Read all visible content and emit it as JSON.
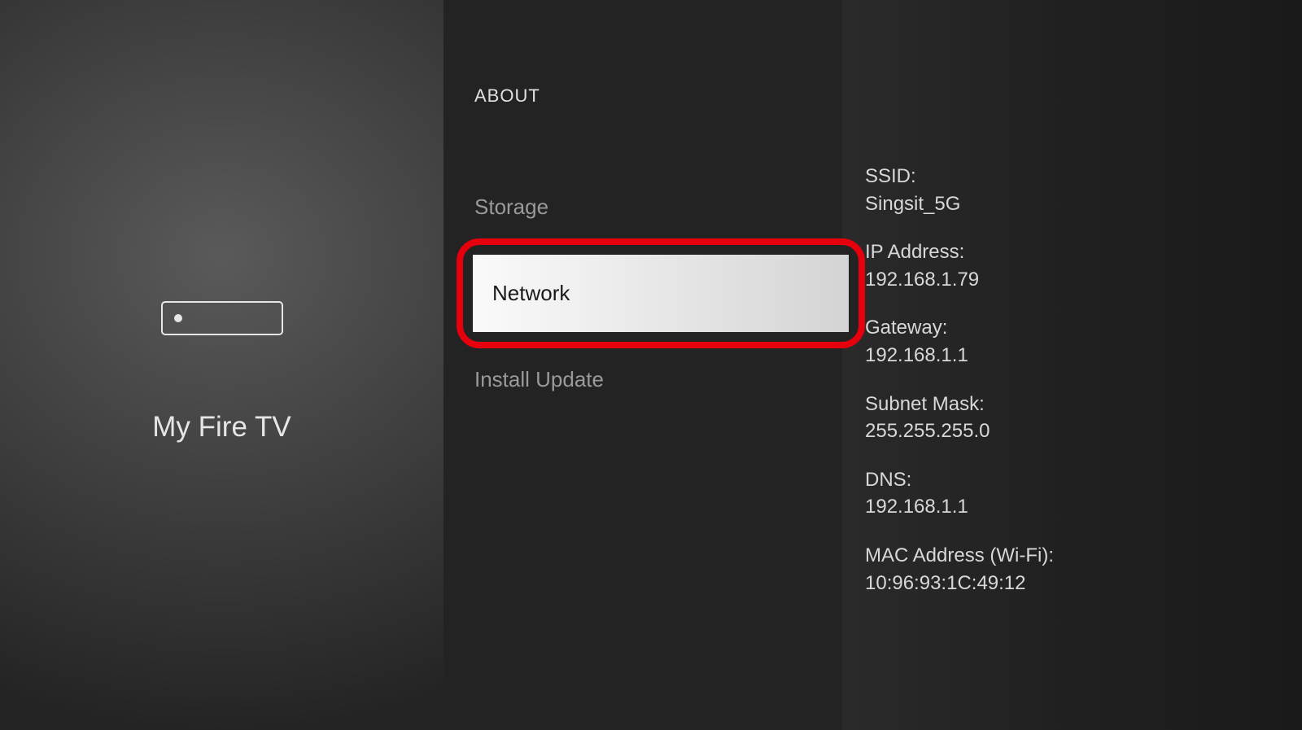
{
  "left": {
    "title": "My Fire TV"
  },
  "middle": {
    "header": "ABOUT",
    "items": [
      {
        "label": "Storage",
        "selected": false
      },
      {
        "label": "Network",
        "selected": true
      },
      {
        "label": "Install Update",
        "selected": false
      }
    ]
  },
  "right": {
    "details": [
      {
        "label": "SSID:",
        "value": "Singsit_5G"
      },
      {
        "label": "IP Address:",
        "value": "192.168.1.79"
      },
      {
        "label": "Gateway:",
        "value": "192.168.1.1"
      },
      {
        "label": "Subnet Mask:",
        "value": "255.255.255.0"
      },
      {
        "label": "DNS:",
        "value": "192.168.1.1"
      },
      {
        "label": "MAC Address (Wi-Fi):",
        "value": "10:96:93:1C:49:12"
      }
    ]
  }
}
